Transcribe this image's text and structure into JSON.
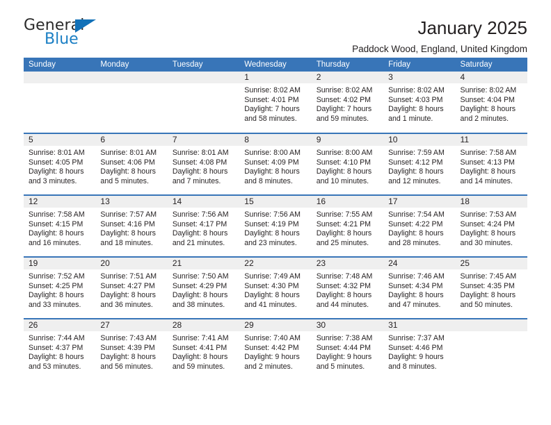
{
  "brand": {
    "name_part1": "General",
    "name_part2": "Blue",
    "triangle_color": "#1271b8",
    "blue_color": "#1b7fc4"
  },
  "header": {
    "title": "January 2025",
    "subtitle": "Paddock Wood, England, United Kingdom",
    "header_bg": "#3875b8",
    "header_text_color": "#ffffff",
    "daynum_bg": "#efefef"
  },
  "weekday_headers": [
    "Sunday",
    "Monday",
    "Tuesday",
    "Wednesday",
    "Thursday",
    "Friday",
    "Saturday"
  ],
  "weeks": [
    [
      {
        "day": "",
        "sunrise": "",
        "sunset": "",
        "daylight1": "",
        "daylight2": ""
      },
      {
        "day": "",
        "sunrise": "",
        "sunset": "",
        "daylight1": "",
        "daylight2": ""
      },
      {
        "day": "",
        "sunrise": "",
        "sunset": "",
        "daylight1": "",
        "daylight2": ""
      },
      {
        "day": "1",
        "sunrise": "Sunrise: 8:02 AM",
        "sunset": "Sunset: 4:01 PM",
        "daylight1": "Daylight: 7 hours",
        "daylight2": "and 58 minutes."
      },
      {
        "day": "2",
        "sunrise": "Sunrise: 8:02 AM",
        "sunset": "Sunset: 4:02 PM",
        "daylight1": "Daylight: 7 hours",
        "daylight2": "and 59 minutes."
      },
      {
        "day": "3",
        "sunrise": "Sunrise: 8:02 AM",
        "sunset": "Sunset: 4:03 PM",
        "daylight1": "Daylight: 8 hours",
        "daylight2": "and 1 minute."
      },
      {
        "day": "4",
        "sunrise": "Sunrise: 8:02 AM",
        "sunset": "Sunset: 4:04 PM",
        "daylight1": "Daylight: 8 hours",
        "daylight2": "and 2 minutes."
      }
    ],
    [
      {
        "day": "5",
        "sunrise": "Sunrise: 8:01 AM",
        "sunset": "Sunset: 4:05 PM",
        "daylight1": "Daylight: 8 hours",
        "daylight2": "and 3 minutes."
      },
      {
        "day": "6",
        "sunrise": "Sunrise: 8:01 AM",
        "sunset": "Sunset: 4:06 PM",
        "daylight1": "Daylight: 8 hours",
        "daylight2": "and 5 minutes."
      },
      {
        "day": "7",
        "sunrise": "Sunrise: 8:01 AM",
        "sunset": "Sunset: 4:08 PM",
        "daylight1": "Daylight: 8 hours",
        "daylight2": "and 7 minutes."
      },
      {
        "day": "8",
        "sunrise": "Sunrise: 8:00 AM",
        "sunset": "Sunset: 4:09 PM",
        "daylight1": "Daylight: 8 hours",
        "daylight2": "and 8 minutes."
      },
      {
        "day": "9",
        "sunrise": "Sunrise: 8:00 AM",
        "sunset": "Sunset: 4:10 PM",
        "daylight1": "Daylight: 8 hours",
        "daylight2": "and 10 minutes."
      },
      {
        "day": "10",
        "sunrise": "Sunrise: 7:59 AM",
        "sunset": "Sunset: 4:12 PM",
        "daylight1": "Daylight: 8 hours",
        "daylight2": "and 12 minutes."
      },
      {
        "day": "11",
        "sunrise": "Sunrise: 7:58 AM",
        "sunset": "Sunset: 4:13 PM",
        "daylight1": "Daylight: 8 hours",
        "daylight2": "and 14 minutes."
      }
    ],
    [
      {
        "day": "12",
        "sunrise": "Sunrise: 7:58 AM",
        "sunset": "Sunset: 4:15 PM",
        "daylight1": "Daylight: 8 hours",
        "daylight2": "and 16 minutes."
      },
      {
        "day": "13",
        "sunrise": "Sunrise: 7:57 AM",
        "sunset": "Sunset: 4:16 PM",
        "daylight1": "Daylight: 8 hours",
        "daylight2": "and 18 minutes."
      },
      {
        "day": "14",
        "sunrise": "Sunrise: 7:56 AM",
        "sunset": "Sunset: 4:17 PM",
        "daylight1": "Daylight: 8 hours",
        "daylight2": "and 21 minutes."
      },
      {
        "day": "15",
        "sunrise": "Sunrise: 7:56 AM",
        "sunset": "Sunset: 4:19 PM",
        "daylight1": "Daylight: 8 hours",
        "daylight2": "and 23 minutes."
      },
      {
        "day": "16",
        "sunrise": "Sunrise: 7:55 AM",
        "sunset": "Sunset: 4:21 PM",
        "daylight1": "Daylight: 8 hours",
        "daylight2": "and 25 minutes."
      },
      {
        "day": "17",
        "sunrise": "Sunrise: 7:54 AM",
        "sunset": "Sunset: 4:22 PM",
        "daylight1": "Daylight: 8 hours",
        "daylight2": "and 28 minutes."
      },
      {
        "day": "18",
        "sunrise": "Sunrise: 7:53 AM",
        "sunset": "Sunset: 4:24 PM",
        "daylight1": "Daylight: 8 hours",
        "daylight2": "and 30 minutes."
      }
    ],
    [
      {
        "day": "19",
        "sunrise": "Sunrise: 7:52 AM",
        "sunset": "Sunset: 4:25 PM",
        "daylight1": "Daylight: 8 hours",
        "daylight2": "and 33 minutes."
      },
      {
        "day": "20",
        "sunrise": "Sunrise: 7:51 AM",
        "sunset": "Sunset: 4:27 PM",
        "daylight1": "Daylight: 8 hours",
        "daylight2": "and 36 minutes."
      },
      {
        "day": "21",
        "sunrise": "Sunrise: 7:50 AM",
        "sunset": "Sunset: 4:29 PM",
        "daylight1": "Daylight: 8 hours",
        "daylight2": "and 38 minutes."
      },
      {
        "day": "22",
        "sunrise": "Sunrise: 7:49 AM",
        "sunset": "Sunset: 4:30 PM",
        "daylight1": "Daylight: 8 hours",
        "daylight2": "and 41 minutes."
      },
      {
        "day": "23",
        "sunrise": "Sunrise: 7:48 AM",
        "sunset": "Sunset: 4:32 PM",
        "daylight1": "Daylight: 8 hours",
        "daylight2": "and 44 minutes."
      },
      {
        "day": "24",
        "sunrise": "Sunrise: 7:46 AM",
        "sunset": "Sunset: 4:34 PM",
        "daylight1": "Daylight: 8 hours",
        "daylight2": "and 47 minutes."
      },
      {
        "day": "25",
        "sunrise": "Sunrise: 7:45 AM",
        "sunset": "Sunset: 4:35 PM",
        "daylight1": "Daylight: 8 hours",
        "daylight2": "and 50 minutes."
      }
    ],
    [
      {
        "day": "26",
        "sunrise": "Sunrise: 7:44 AM",
        "sunset": "Sunset: 4:37 PM",
        "daylight1": "Daylight: 8 hours",
        "daylight2": "and 53 minutes."
      },
      {
        "day": "27",
        "sunrise": "Sunrise: 7:43 AM",
        "sunset": "Sunset: 4:39 PM",
        "daylight1": "Daylight: 8 hours",
        "daylight2": "and 56 minutes."
      },
      {
        "day": "28",
        "sunrise": "Sunrise: 7:41 AM",
        "sunset": "Sunset: 4:41 PM",
        "daylight1": "Daylight: 8 hours",
        "daylight2": "and 59 minutes."
      },
      {
        "day": "29",
        "sunrise": "Sunrise: 7:40 AM",
        "sunset": "Sunset: 4:42 PM",
        "daylight1": "Daylight: 9 hours",
        "daylight2": "and 2 minutes."
      },
      {
        "day": "30",
        "sunrise": "Sunrise: 7:38 AM",
        "sunset": "Sunset: 4:44 PM",
        "daylight1": "Daylight: 9 hours",
        "daylight2": "and 5 minutes."
      },
      {
        "day": "31",
        "sunrise": "Sunrise: 7:37 AM",
        "sunset": "Sunset: 4:46 PM",
        "daylight1": "Daylight: 9 hours",
        "daylight2": "and 8 minutes."
      },
      {
        "day": "",
        "sunrise": "",
        "sunset": "",
        "daylight1": "",
        "daylight2": ""
      }
    ]
  ]
}
